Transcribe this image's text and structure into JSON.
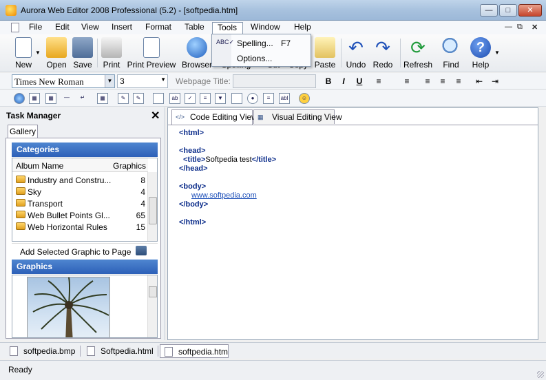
{
  "window": {
    "title": "Aurora Web Editor 2008 Professional (5.2) - [softpedia.htm]"
  },
  "menu": [
    "File",
    "Edit",
    "View",
    "Insert",
    "Format",
    "Table",
    "Tools",
    "Window",
    "Help"
  ],
  "tools_menu": [
    {
      "label": "Spelling...",
      "shortcut": "F7"
    },
    {
      "label": "Options...",
      "shortcut": ""
    }
  ],
  "toolbar": {
    "new": "New",
    "open": "Open",
    "save": "Save",
    "print": "Print",
    "print_preview": "Print Preview",
    "browser": "Browser",
    "spelling": "Spelling",
    "cut": "Cut",
    "copy": "Copy",
    "paste": "Paste",
    "undo": "Undo",
    "redo": "Redo",
    "refresh": "Refresh",
    "find": "Find",
    "help": "Help"
  },
  "format": {
    "font": "Times New Roman",
    "size": "3",
    "webpage_title_label": "Webpage Title:",
    "webpage_title_value": "",
    "bold": "B",
    "italic": "I",
    "underline": "U"
  },
  "task_manager": {
    "title": "Task Manager",
    "tab": "Gallery",
    "categories_header": "Categories",
    "col_album": "Album Name",
    "col_graphics": "Graphics",
    "albums": [
      {
        "name": "Industry and Constru...",
        "count": "8"
      },
      {
        "name": "Sky",
        "count": "4"
      },
      {
        "name": "Transport",
        "count": "4"
      },
      {
        "name": "Web Bullet Points Gl...",
        "count": "65"
      },
      {
        "name": "Web Horizontal Rules",
        "count": "15"
      }
    ],
    "add_selected": "Add Selected Graphic to Page",
    "graphics_header": "Graphics"
  },
  "editor": {
    "tabs": [
      "Code Editing View",
      "Visual Editing View"
    ],
    "code_lines": {
      "l1_tag": "<html>",
      "l2_tag": "<head>",
      "l3_open": "<title>",
      "l3_text": "Softpedia test",
      "l3_close": "</title>",
      "l4_tag": "</head>",
      "l5_tag": "<body>",
      "l6_link": "www.softpedia.com",
      "l7_tag": "</body>",
      "l8_tag": "</html>"
    }
  },
  "doc_tabs": [
    "softpedia.bmp",
    "Softpedia.html",
    "softpedia.htm"
  ],
  "status": "Ready"
}
